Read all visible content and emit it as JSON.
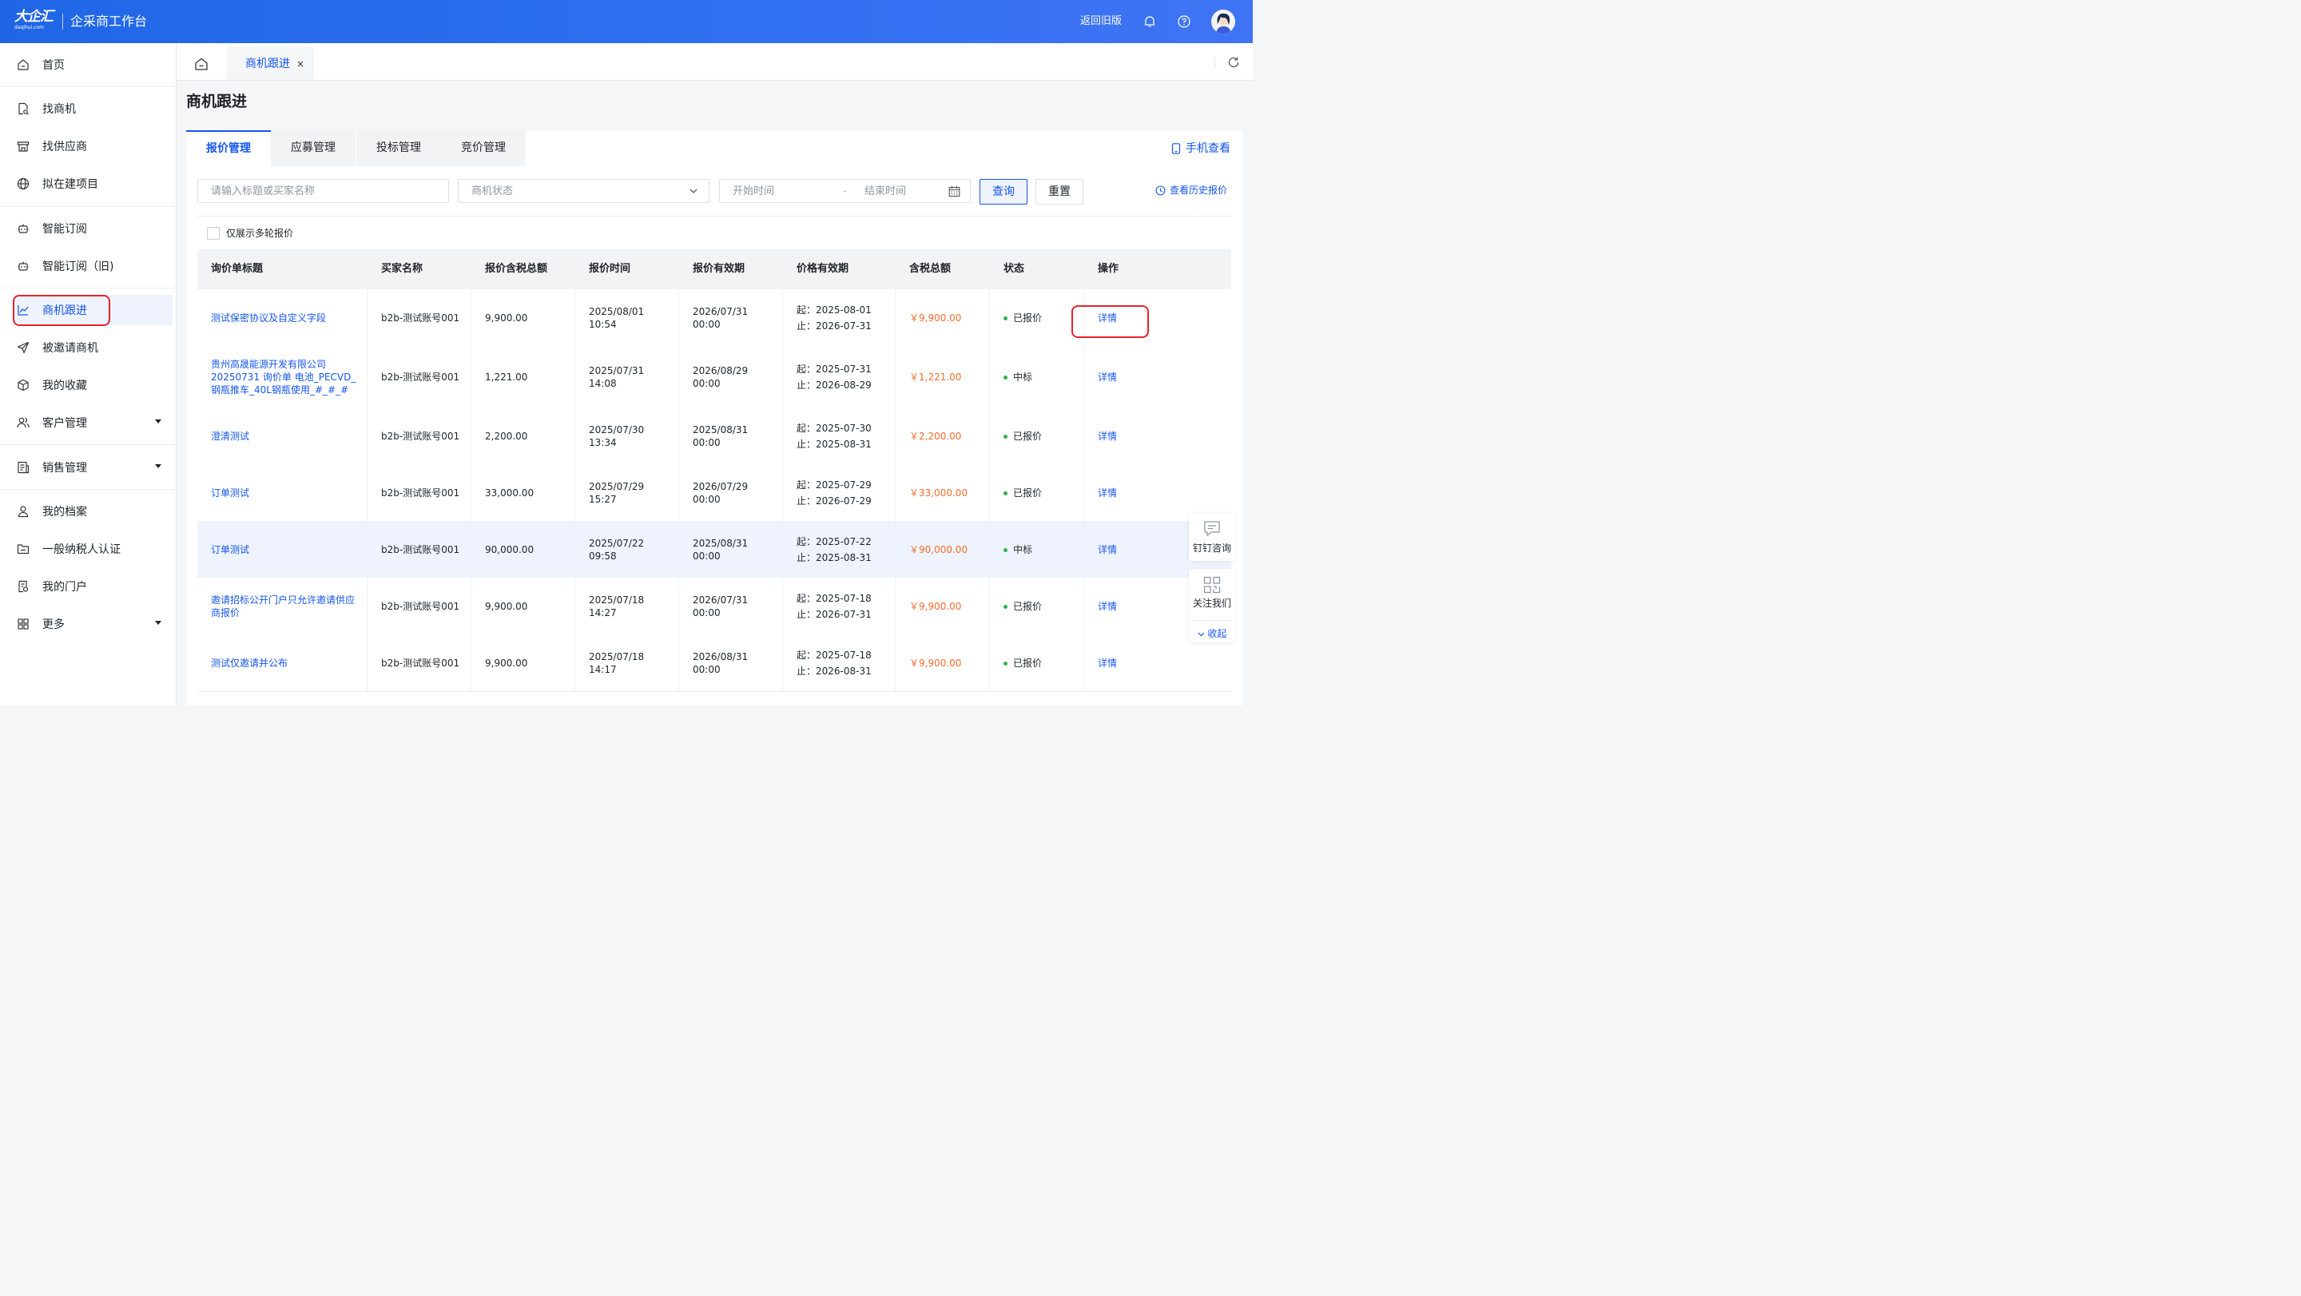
{
  "header": {
    "logo_text": "大企汇",
    "logo_sub": "daqihui.com",
    "app_title": "企采商工作台",
    "back_old": "返回旧版",
    "brand_color": "#1f66e6"
  },
  "sidebar": {
    "items": [
      {
        "label": "首页",
        "icon": "home-icon"
      },
      {
        "label": "找商机",
        "icon": "document-search-icon"
      },
      {
        "label": "找供应商",
        "icon": "store-icon"
      },
      {
        "label": "拟在建项目",
        "icon": "globe-icon"
      },
      {
        "label": "智能订阅",
        "icon": "robot-icon"
      },
      {
        "label": "智能订阅（旧)",
        "icon": "robot-icon"
      },
      {
        "label": "商机跟进",
        "icon": "chart-icon"
      },
      {
        "label": "被邀请商机",
        "icon": "send-icon"
      },
      {
        "label": "我的收藏",
        "icon": "cube-icon"
      },
      {
        "label": "客户管理",
        "icon": "users-icon"
      },
      {
        "label": "销售管理",
        "icon": "report-icon"
      },
      {
        "label": "我的档案",
        "icon": "user-icon"
      },
      {
        "label": "一般纳税人认证",
        "icon": "folder-icon"
      },
      {
        "label": "我的门户",
        "icon": "portal-icon"
      },
      {
        "label": "更多",
        "icon": "grid-icon"
      }
    ]
  },
  "tabs": {
    "current": "商机跟进",
    "close": "×"
  },
  "page": {
    "title": "商机跟进",
    "sub_tabs": [
      "报价管理",
      "应募管理",
      "投标管理",
      "竞价管理"
    ],
    "mobile_view": "手机查看",
    "history_view": "查看历史报价"
  },
  "filters": {
    "keyword_placeholder": "请输入标题或买家名称",
    "status_placeholder": "商机状态",
    "start_placeholder": "开始时间",
    "range_sep": "-",
    "end_placeholder": "结束时间",
    "query_button": "查询",
    "reset_button": "重置",
    "multi_round_label": "仅展示多轮报价"
  },
  "table": {
    "headers": [
      "询价单标题",
      "买家名称",
      "报价含税总额",
      "报价时间",
      "报价有效期",
      "价格有效期",
      "含税总额",
      "状态",
      "操作"
    ],
    "rows": [
      {
        "title": "测试保密协议及自定义字段",
        "buyer": "b2b-测试账号001",
        "amount": "9,900.00",
        "quote_time": "2025/08/01 10:54",
        "valid_until": "2026/07/31 00:00",
        "price_from": "起：2025-08-01",
        "price_to": "止：2026-07-31",
        "total": "￥9,900.00",
        "status": "已报价",
        "action": "详情"
      },
      {
        "title": "贵州高晟能源开发有限公司 20250731 询价单 电池_PECVD_钢瓶推车_40L钢瓶使用_#_#_#",
        "buyer": "b2b-测试账号001",
        "amount": "1,221.00",
        "quote_time": "2025/07/31 14:08",
        "valid_until": "2026/08/29 00:00",
        "price_from": "起：2025-07-31",
        "price_to": "止：2026-08-29",
        "total": "￥1,221.00",
        "status": "中标",
        "action": "详情"
      },
      {
        "title": "澄清测试",
        "buyer": "b2b-测试账号001",
        "amount": "2,200.00",
        "quote_time": "2025/07/30 13:34",
        "valid_until": "2025/08/31 00:00",
        "price_from": "起：2025-07-30",
        "price_to": "止：2025-08-31",
        "total": "￥2,200.00",
        "status": "已报价",
        "action": "详情"
      },
      {
        "title": "订单测试",
        "buyer": "b2b-测试账号001",
        "amount": "33,000.00",
        "quote_time": "2025/07/29 15:27",
        "valid_until": "2026/07/29 00:00",
        "price_from": "起：2025-07-29",
        "price_to": "止：2026-07-29",
        "total": "￥33,000.00",
        "status": "已报价",
        "action": "详情"
      },
      {
        "title": "订单测试",
        "buyer": "b2b-测试账号001",
        "amount": "90,000.00",
        "quote_time": "2025/07/22 09:58",
        "valid_until": "2025/08/31 00:00",
        "price_from": "起：2025-07-22",
        "price_to": "止：2025-08-31",
        "total": "￥90,000.00",
        "status": "中标",
        "action": "详情"
      },
      {
        "title": "邀请招标公开门户只允许邀请供应商报价",
        "buyer": "b2b-测试账号001",
        "amount": "9,900.00",
        "quote_time": "2025/07/18 14:27",
        "valid_until": "2026/07/31 00:00",
        "price_from": "起：2025-07-18",
        "price_to": "止：2026-07-31",
        "total": "￥9,900.00",
        "status": "已报价",
        "action": "详情"
      },
      {
        "title": "测试仅邀请并公布",
        "buyer": "b2b-测试账号001",
        "amount": "9,900.00",
        "quote_time": "2025/07/18 14:17",
        "valid_until": "2026/08/31 00:00",
        "price_from": "起：2025-07-18",
        "price_to": "止：2026-08-31",
        "total": "￥9,900.00",
        "status": "已报价",
        "action": "详情"
      }
    ]
  },
  "float": {
    "dingtalk": "钉钉咨询",
    "follow": "关注我们",
    "collapse": "收起"
  }
}
